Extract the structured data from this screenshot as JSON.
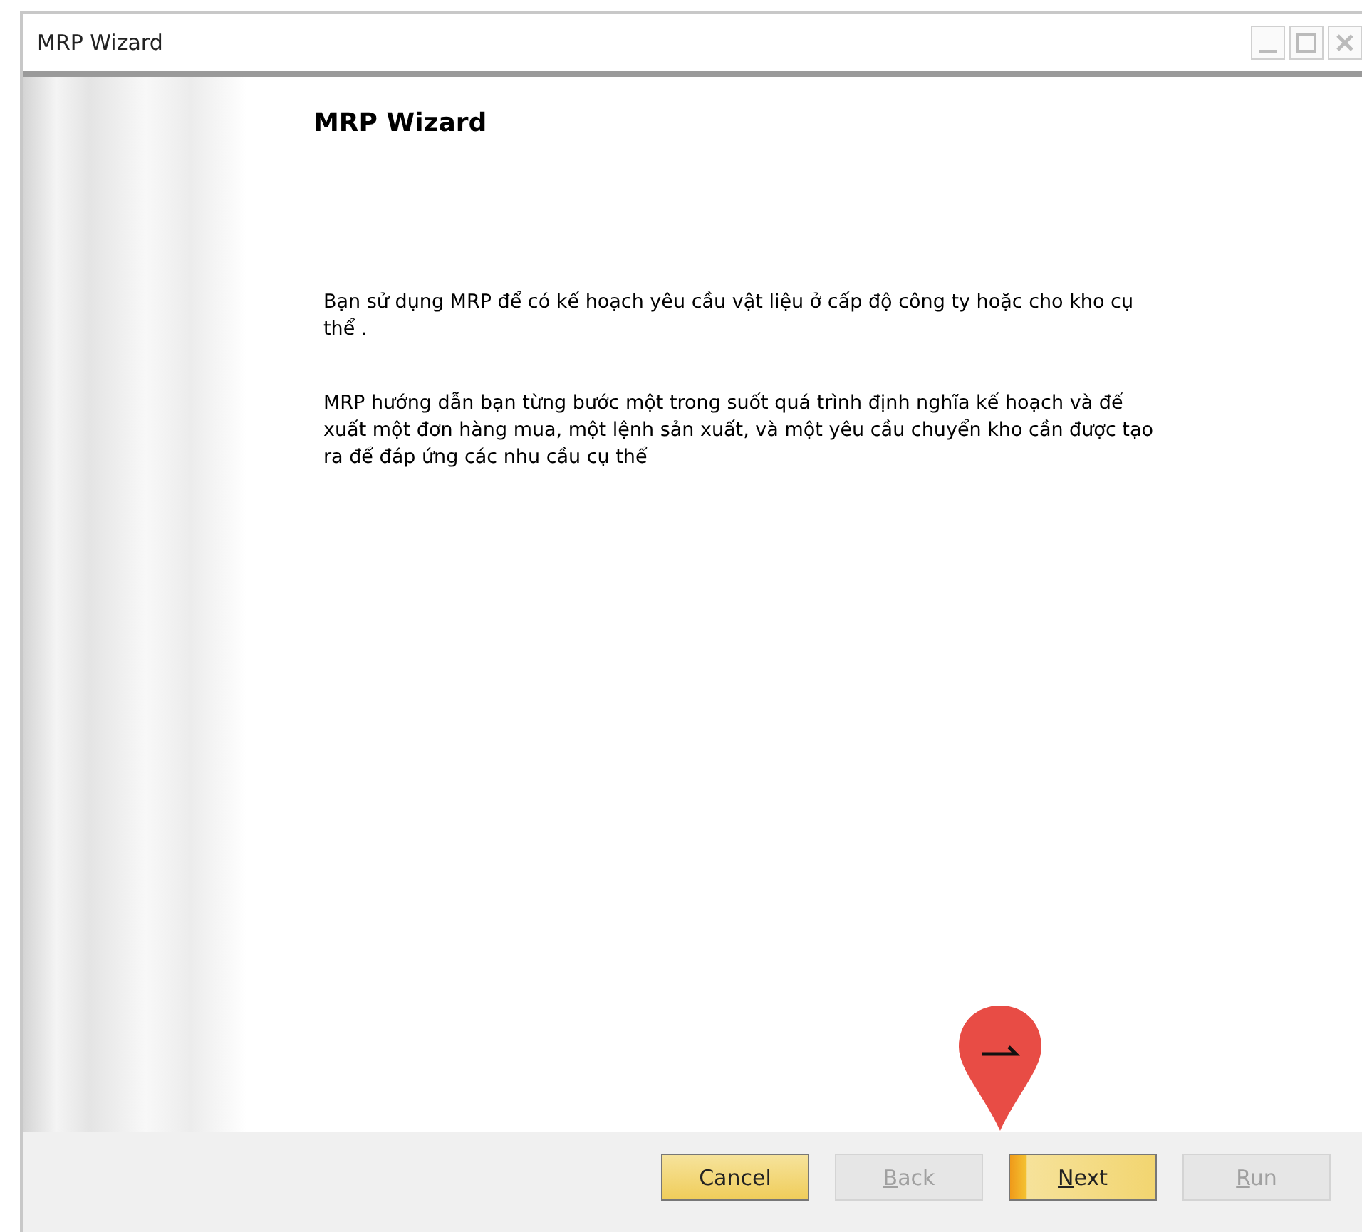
{
  "window": {
    "title": "MRP Wizard"
  },
  "page": {
    "heading": "MRP Wizard",
    "paragraphs": [
      "Bạn sử dụng MRP để có kế hoạch yêu cầu vật liệu ở cấp độ công ty hoặc cho kho cụ thể .",
      "MRP hướng dẫn bạn từng bước một trong suốt quá trình định nghĩa kế hoạch và đế xuất một đơn hàng mua, một lệnh sản xuất, và một yêu cầu chuyển kho cần được tạo ra để đáp ứng các nhu cầu cụ thể"
    ]
  },
  "buttons": [
    {
      "label": "Cancel",
      "mnemonic": false,
      "disabled": false,
      "default": false
    },
    {
      "label": "Back",
      "mnemonic": true,
      "disabled": true,
      "default": false
    },
    {
      "label": "Next",
      "mnemonic": true,
      "disabled": false,
      "default": true
    },
    {
      "label": "Run",
      "mnemonic": true,
      "disabled": true,
      "default": false
    }
  ]
}
